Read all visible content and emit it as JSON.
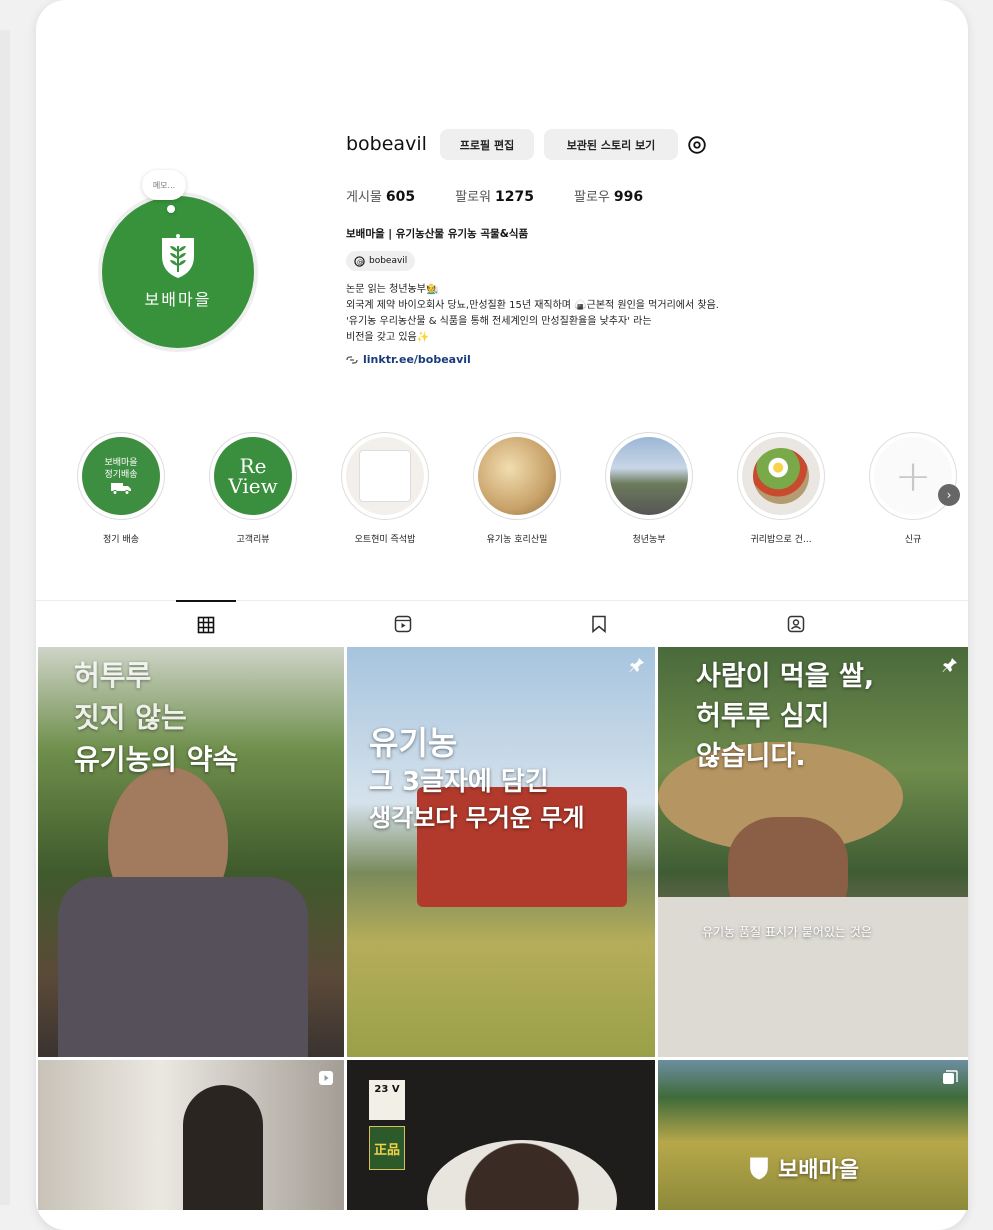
{
  "profile": {
    "username": "bobeavil",
    "edit_label": "프로필 편집",
    "archive_label": "보관된 스토리 보기",
    "note": "메모...",
    "avatar_label": "보배마을",
    "stats": [
      {
        "label": "게시물",
        "value": "605"
      },
      {
        "label": "팔로워",
        "value": "1275"
      },
      {
        "label": "팔로우",
        "value": "996"
      }
    ],
    "bio_name": "보배마을 | 유기농산물 유기농 곡물&식품",
    "threads_handle": "bobeavil",
    "bio_lines": [
      "논문 읽는 청년농부🧑‍🌾",
      "외국계 제약 바이오회사 당뇨,만성질환 15년 재직하며 🍙근본적 원인을 먹거리에서 찾음.",
      "'유기농 우리농산물 & 식품을 통해 전세계인의 만성질환율을 낮추자' 라는",
      "비전을 갖고 있음✨"
    ],
    "link": "linktr.ee/bobeavil"
  },
  "highlights": [
    {
      "label": "정기 배송",
      "badge": "보배마을\n정기배송"
    },
    {
      "label": "고객리뷰",
      "badge": "Re View"
    },
    {
      "label": "오트현미 즉석밥",
      "badge": ""
    },
    {
      "label": "유기농 호리산밀",
      "badge": ""
    },
    {
      "label": "청년농부",
      "badge": ""
    },
    {
      "label": "귀리밥으로 건...",
      "badge": ""
    },
    {
      "label": "신규",
      "badge": "+"
    }
  ],
  "tabs": [
    "posts",
    "reels",
    "saved",
    "tagged"
  ],
  "posts": [
    {
      "lines": [
        "허투루",
        "짓지 않는",
        "유기농의 약속"
      ]
    },
    {
      "lines": [
        "유기농",
        "그 3글자에 담긴",
        "생각보다 무거운 무게"
      ]
    },
    {
      "lines": [
        "사람이 먹을 쌀,",
        "허투루 심지",
        "않습니다."
      ],
      "caption": "유기농 품질 표시가 붙어있는 것은"
    },
    {
      "lines": []
    },
    {
      "lines": [],
      "badge1": "23 V",
      "badge2": "正品"
    },
    {
      "lines": [
        "보배마을"
      ]
    }
  ],
  "colors": {
    "brand_green": "#37923b",
    "text": "#111111",
    "link": "#1a3b79"
  }
}
